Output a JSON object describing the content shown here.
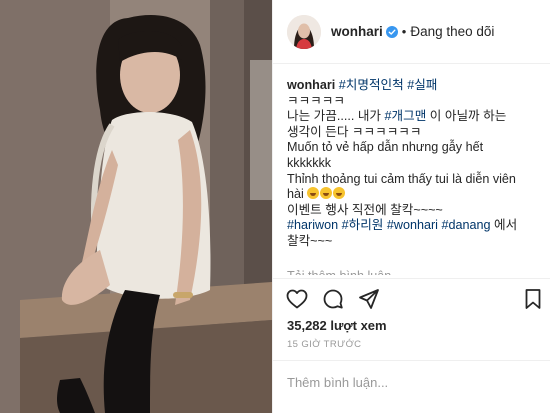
{
  "post": {
    "username": "wonhari",
    "follow_status": "Đang theo dõi",
    "caption_lines": [
      {
        "user": "wonhari",
        "tags": [
          "#치명적인척",
          "#실패"
        ]
      },
      {
        "text": "ㅋㅋㅋㅋㅋ"
      },
      {
        "pre": "나는 가끔..... 내가 ",
        "tag": "#개그맨",
        "post": " 이 아닐까 하는"
      },
      {
        "text": "생각이 든다 ㅋㅋㅋㅋㅋㅋ"
      },
      {
        "text": "Muốn tỏ vẻ hấp dẫn nhưng gẫy hết"
      },
      {
        "text": "kkkkkkk"
      },
      {
        "text": "Thỉnh thoảng tui cảm thấy tui là diễn viên"
      },
      {
        "text": "hài"
      },
      {
        "text": "이벤트 행사 직전에 찰칵~~~~"
      },
      {
        "tags": [
          "#hariwon",
          "#하리원",
          "#wonhari",
          "#danang"
        ],
        "post": " 에서"
      },
      {
        "text": "찰칵~~~"
      }
    ],
    "load_more": "Tải thêm bình luận",
    "views": "35,282 lượt xem",
    "timestamp": "15 GIỜ TRƯỚC",
    "comment_placeholder": "Thêm bình luận..."
  },
  "icons": {
    "verified": "verified-badge-icon",
    "like": "heart-icon",
    "comment": "comment-icon",
    "share": "share-icon",
    "save": "bookmark-icon"
  },
  "colors": {
    "hashtag": "#003569",
    "verified": "#3897f0",
    "muted": "#999999"
  }
}
